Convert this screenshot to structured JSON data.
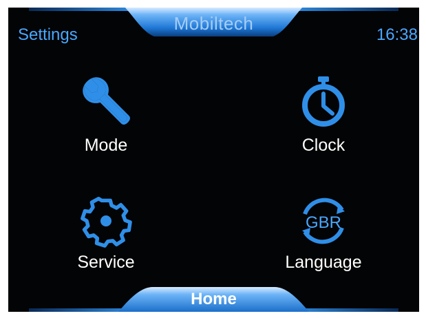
{
  "header": {
    "brand": "Mobiltech",
    "screen_title": "Settings",
    "time": "16:38"
  },
  "menu": {
    "items": [
      {
        "label": "Mode",
        "icon": "wrench-icon"
      },
      {
        "label": "Clock",
        "icon": "stopwatch-icon"
      },
      {
        "label": "Service",
        "icon": "gear-icon"
      },
      {
        "label": "Language",
        "icon": "language-icon",
        "icon_text": "GBR"
      }
    ]
  },
  "footer": {
    "home_label": "Home"
  },
  "colors": {
    "accent": "#2f8fe8",
    "background": "#030405",
    "label": "#ffffff",
    "header_text": "#4aa7ff"
  }
}
